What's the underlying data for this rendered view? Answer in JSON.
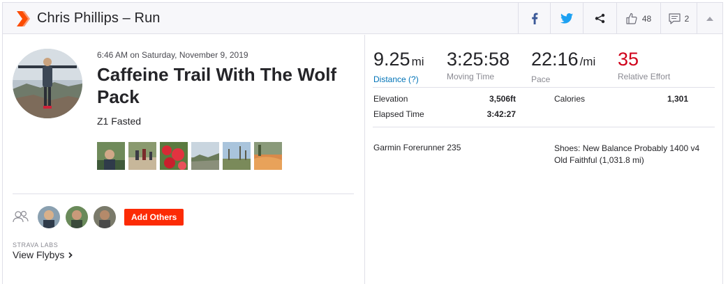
{
  "header": {
    "title": "Chris Phillips – Run",
    "kudos_count": "48",
    "comment_count": "2"
  },
  "activity": {
    "datetime": "6:46 AM on Saturday, November 9, 2019",
    "name": "Caffeine Trail With The Wolf Pack",
    "description": "Z1 Fasted",
    "photo_count": 6
  },
  "group": {
    "add_others_label": "Add Others",
    "labs_label": "STRAVA LABS",
    "flybys_label": "View Flybys"
  },
  "stats": {
    "distance": {
      "value": "9.25",
      "unit": "mi",
      "label": "Distance (?)"
    },
    "moving_time": {
      "value": "3:25:58",
      "label": "Moving Time"
    },
    "pace": {
      "value": "22:16",
      "unit": "/mi",
      "label": "Pace"
    },
    "relative_effort": {
      "value": "35",
      "label": "Relative Effort"
    }
  },
  "details": {
    "elevation_label": "Elevation",
    "elevation_value": "3,506ft",
    "elapsed_label": "Elapsed Time",
    "elapsed_value": "3:42:27",
    "calories_label": "Calories",
    "calories_value": "1,301"
  },
  "gear": {
    "device": "Garmin Forerunner 235",
    "shoes_line1": "Shoes: New Balance Probably 1400 v4",
    "shoes_line2": "Old Faithful (1,031.8 mi)"
  },
  "colors": {
    "brand": "#fc4c02",
    "accent_red": "#d0021b",
    "button_red": "#fc2b05",
    "link_blue": "#0073b7",
    "facebook": "#3b5998",
    "twitter": "#1da1f2"
  },
  "icons": [
    "strava-chevron-icon",
    "facebook-icon",
    "twitter-icon",
    "share-icon",
    "thumbs-up-icon",
    "comment-icon",
    "caret-up-icon",
    "group-icon",
    "chevron-right-icon"
  ]
}
